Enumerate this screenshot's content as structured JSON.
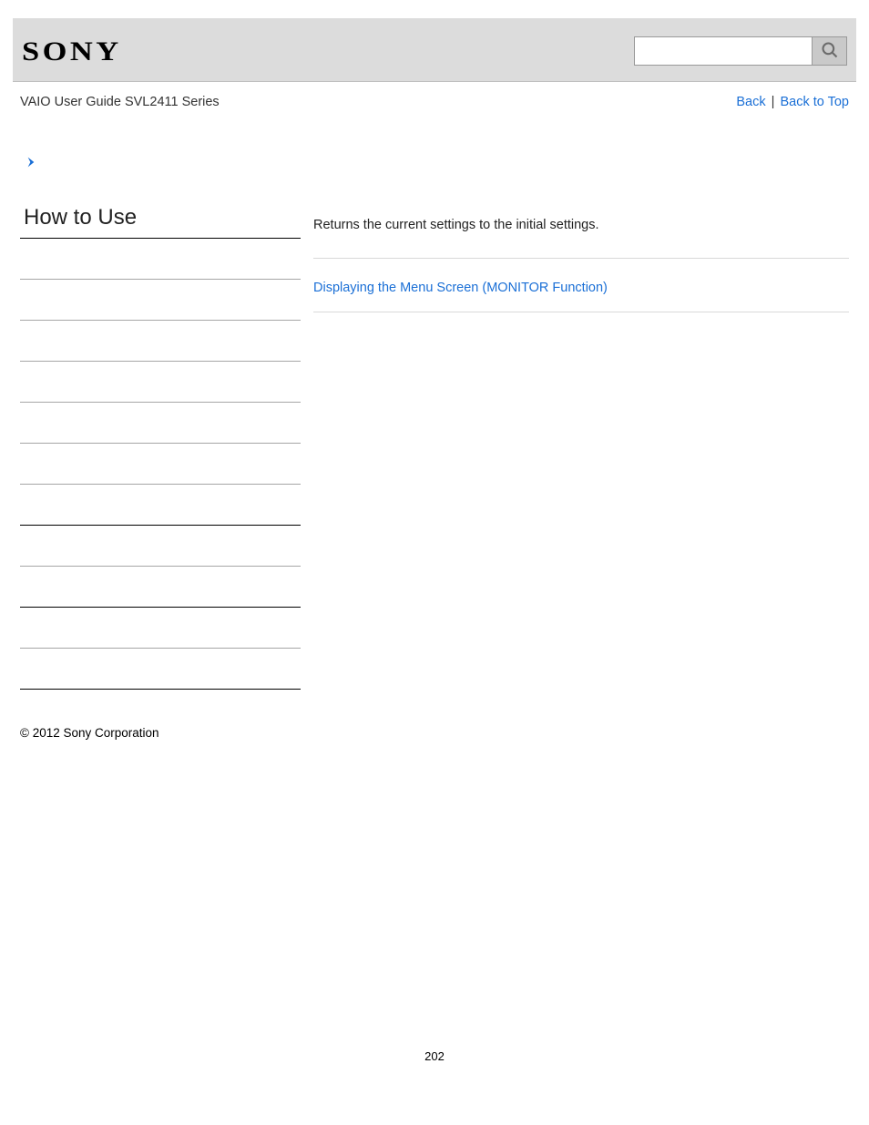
{
  "header": {
    "logo_text": "SONY",
    "search_placeholder": ""
  },
  "subhead": {
    "breadcrumb": "VAIO User Guide SVL2411 Series",
    "back_label": "Back",
    "back_to_top_label": "Back to Top",
    "separator": "|"
  },
  "sidebar": {
    "title": "How to Use",
    "items": [
      "",
      "",
      "",
      "",
      "",
      "",
      "",
      "",
      "",
      "",
      ""
    ]
  },
  "main": {
    "description": "Returns the current settings to the initial settings.",
    "related_link": "Displaying the Menu Screen (MONITOR Function)"
  },
  "footer": {
    "copyright": "© 2012 Sony Corporation",
    "page_number": "202"
  }
}
